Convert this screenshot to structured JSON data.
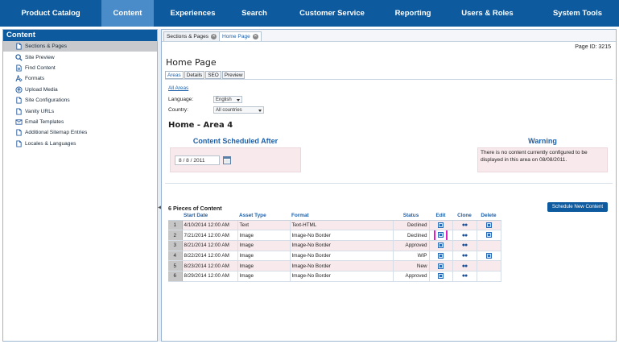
{
  "topnav": {
    "items": [
      {
        "label": "Product Catalog"
      },
      {
        "label": "Content"
      },
      {
        "label": "Experiences"
      },
      {
        "label": "Search"
      },
      {
        "label": "Customer Service"
      },
      {
        "label": "Reporting"
      },
      {
        "label": "Users & Roles"
      },
      {
        "label": "System Tools"
      }
    ],
    "active": "Content",
    "accent": "#0d5a9f"
  },
  "sidebar": {
    "title": "Content",
    "items": [
      {
        "label": "Sections & Pages",
        "icon": "document-icon"
      },
      {
        "label": "Site Preview",
        "icon": "magnifier-icon"
      },
      {
        "label": "Find Content",
        "icon": "find-document-icon"
      },
      {
        "label": "Formats",
        "icon": "format-icon"
      },
      {
        "label": "Upload Media",
        "icon": "upload-icon"
      },
      {
        "label": "Site Configurations",
        "icon": "document-icon"
      },
      {
        "label": "Vanity URLs",
        "icon": "document-icon"
      },
      {
        "label": "Email Templates",
        "icon": "envelope-icon"
      },
      {
        "label": "Additional Sitemap Entries",
        "icon": "document-icon"
      },
      {
        "label": "Locales & Languages",
        "icon": "document-icon"
      }
    ]
  },
  "doc_tabs": [
    {
      "label": "Sections & Pages"
    },
    {
      "label": "Home Page"
    }
  ],
  "page": {
    "id_label": "Page ID: 3215",
    "title": "Home Page",
    "tabs": [
      {
        "label": "Areas"
      },
      {
        "label": "Details"
      },
      {
        "label": "SEO"
      },
      {
        "label": "Preview"
      }
    ],
    "all_areas_link": "All Areas",
    "language_label": "Language:",
    "language_value": "English",
    "country_label": "Country:",
    "country_value": "All countries",
    "area_title": "Home - Area 4",
    "schedule": {
      "heading": "Content Scheduled After",
      "date_value": "8 / 8 / 2011"
    },
    "warning": {
      "heading": "Warning",
      "text": "There is no content currently configured to be displayed in this area on 08/08/2011."
    },
    "pieces_label": "6 Pieces of Content",
    "schedule_button": "Schedule New Content"
  },
  "table": {
    "headers": [
      "",
      "Start Date",
      "Asset Type",
      "Format",
      "Status",
      "Edit",
      "Clone",
      "Delete"
    ],
    "rows": [
      {
        "n": "1",
        "date": "4/10/2014 12:00 AM",
        "type": "Text",
        "format": "Text-HTML",
        "status": "Declined",
        "delete": true
      },
      {
        "n": "2",
        "date": "7/21/2014 12:00 AM",
        "type": "Image",
        "format": "Image-No Border",
        "status": "Declined",
        "delete": true
      },
      {
        "n": "3",
        "date": "8/21/2014 12:00 AM",
        "type": "Image",
        "format": "Image-No Border",
        "status": "Approved",
        "delete": false
      },
      {
        "n": "4",
        "date": "8/22/2014 12:00 AM",
        "type": "Image",
        "format": "Image-No Border",
        "status": "WIP",
        "delete": true
      },
      {
        "n": "5",
        "date": "8/23/2014 12:00 AM",
        "type": "Image",
        "format": "Image-No Border",
        "status": "New",
        "delete": false
      },
      {
        "n": "6",
        "date": "8/29/2014 12:00 AM",
        "type": "Image",
        "format": "Image-No Border",
        "status": "Approved",
        "delete": false
      }
    ],
    "highlight_color": "#e01fc6"
  }
}
